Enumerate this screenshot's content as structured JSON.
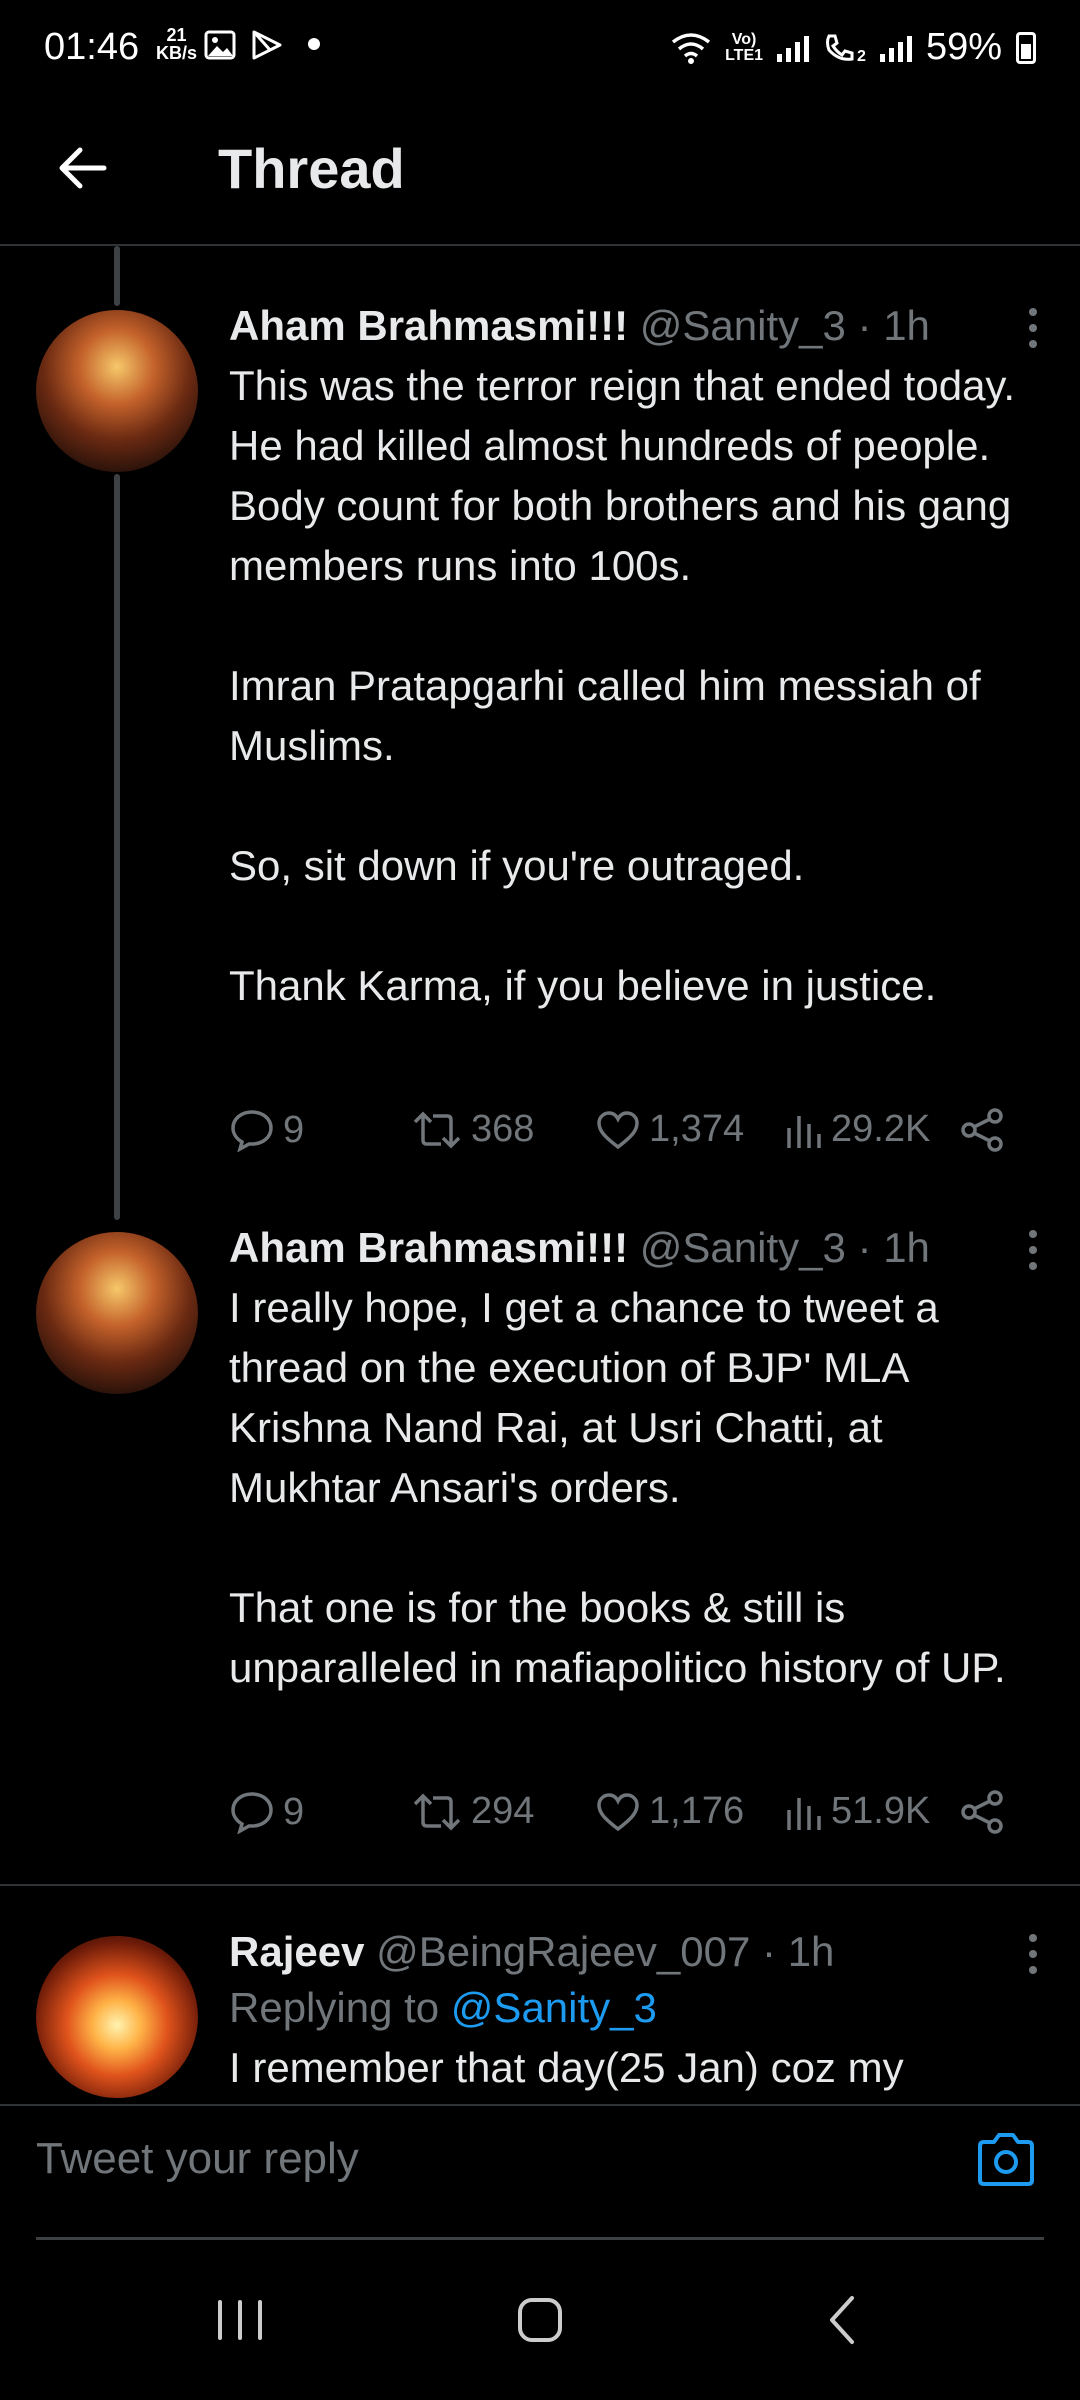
{
  "status_bar": {
    "time": "01:46",
    "net_speed_value": "21",
    "net_speed_unit": "KB/s",
    "lte_label_top": "Vo)",
    "lte_label_bottom": "LTE1",
    "sim2_label": "2",
    "battery": "59%"
  },
  "header": {
    "title": "Thread"
  },
  "tweets": [
    {
      "name": "Aham Brahmasmi!!!",
      "handle": "@Sanity_3",
      "sep": "·",
      "ago": "1h",
      "text": "This was the terror reign that ended today.\nHe had killed almost hundreds of people. Body count for both brothers and his gang members runs into 100s.\n\nImran Pratapgarhi called him messiah of Muslims.\n\nSo, sit down if you're outraged.\n\nThank Karma, if you believe in justice.",
      "replies": "9",
      "retweets": "368",
      "likes": "1,374",
      "views": "29.2K"
    },
    {
      "name": "Aham Brahmasmi!!!",
      "handle": "@Sanity_3",
      "sep": "·",
      "ago": "1h",
      "text": "I really hope, I get a chance to tweet a thread on the execution of BJP' MLA Krishna Nand Rai, at Usri Chatti, at Mukhtar Ansari's orders.\n\nThat one is for the books & still is unparalleled in mafiapolitico history of UP.",
      "replies": "9",
      "retweets": "294",
      "likes": "1,176",
      "views": "51.9K"
    },
    {
      "name": "Rajeev",
      "handle": "@BeingRajeev_007",
      "sep": "·",
      "ago": "1h",
      "replying_prefix": "Replying to",
      "replying_to": "@Sanity_3",
      "text": "I remember that day(25 Jan) coz my"
    }
  ],
  "reply_bar": {
    "placeholder": "Tweet your reply"
  },
  "icons": {
    "back": "arrow-left-icon",
    "more": "more-vertical-icon",
    "reply": "reply-bubble-icon",
    "retweet": "retweet-icon",
    "like": "heart-icon",
    "views": "analytics-bars-icon",
    "share": "share-icon",
    "camera": "camera-icon"
  },
  "colors": {
    "background": "#000000",
    "text": "#e7e9ea",
    "muted": "#71767b",
    "accent": "#1d9bf0"
  }
}
